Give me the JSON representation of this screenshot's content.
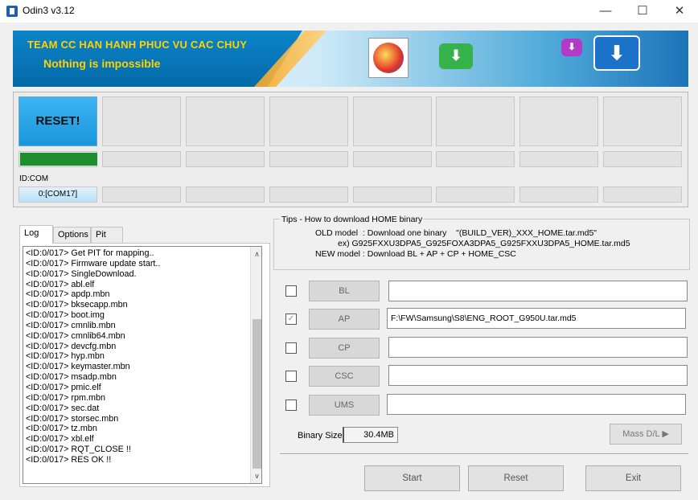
{
  "window": {
    "title": "Odin3 v3.12",
    "minimize_glyph": "—",
    "maximize_glyph": "☐",
    "close_glyph": "✕"
  },
  "banner": {
    "line1": "TEAM CC HAN HANH PHUC VU CAC CHUY",
    "line2": "Nothing is impossible",
    "download_glyph": "⬇"
  },
  "slots": {
    "reset_label": "RESET!",
    "progress_1_fraction": 1.0,
    "id_com_label": "ID:COM",
    "com_1": "0:[COM17]"
  },
  "tabs": [
    "Log",
    "Options",
    "Pit"
  ],
  "log": {
    "lines": [
      "<ID:0/017> Get PIT for mapping..",
      "<ID:0/017> Firmware update start..",
      "<ID:0/017> SingleDownload.",
      "<ID:0/017> abl.elf",
      "<ID:0/017> apdp.mbn",
      "<ID:0/017> bksecapp.mbn",
      "<ID:0/017> boot.img",
      "<ID:0/017> cmnlib.mbn",
      "<ID:0/017> cmnlib64.mbn",
      "<ID:0/017> devcfg.mbn",
      "<ID:0/017> hyp.mbn",
      "<ID:0/017> keymaster.mbn",
      "<ID:0/017> msadp.mbn",
      "<ID:0/017> pmic.elf",
      "<ID:0/017> rpm.mbn",
      "<ID:0/017> sec.dat",
      "<ID:0/017> storsec.mbn",
      "<ID:0/017> tz.mbn",
      "<ID:0/017> xbl.elf",
      "<ID:0/017> RQT_CLOSE !!",
      "<ID:0/017> RES OK !!"
    ],
    "scroll_up": "∧",
    "scroll_down": "∨"
  },
  "tips": {
    "title": "Tips - How to download HOME binary",
    "old_model": "OLD model  : Download one binary    \"(BUILD_VER)_XXX_HOME.tar.md5\"",
    "example": "ex) G925FXXU3DPA5_G925FOXA3DPA5_G925FXXU3DPA5_HOME.tar.md5",
    "new_model": "NEW model : Download BL + AP + CP + HOME_CSC"
  },
  "files": [
    {
      "label": "BL",
      "checked": false,
      "path": ""
    },
    {
      "label": "AP",
      "checked": true,
      "path": "F:\\FW\\Samsung\\S8\\ENG_ROOT_G950U.tar.md5"
    },
    {
      "label": "CP",
      "checked": false,
      "path": ""
    },
    {
      "label": "CSC",
      "checked": false,
      "path": ""
    },
    {
      "label": "UMS",
      "checked": false,
      "path": ""
    }
  ],
  "check_glyph": "✓",
  "binary_size": {
    "label": "Binary Size",
    "value": "30.4MB"
  },
  "buttons": {
    "mass_dl": "Mass D/L ▶",
    "start": "Start",
    "reset": "Reset",
    "exit": "Exit"
  }
}
